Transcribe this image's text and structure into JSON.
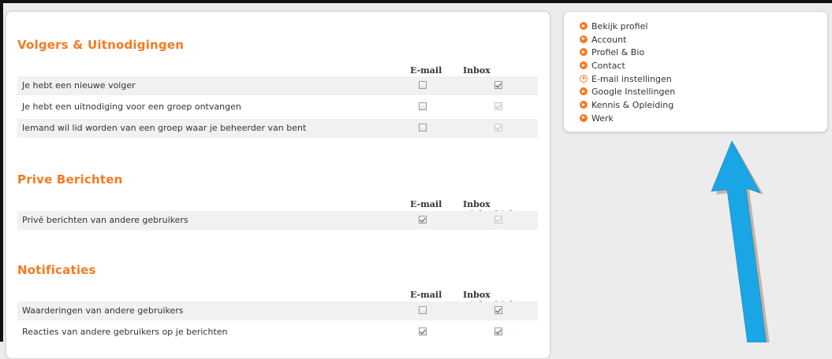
{
  "sections": [
    {
      "title": "Volgers & Uitnodigingen",
      "col_email": "E-mail",
      "col_inbox": "Inbox Biebtobieb",
      "rows": [
        {
          "label": "Je hebt een nieuwe volger",
          "email": false,
          "inbox": true,
          "inbox_disabled": false
        },
        {
          "label": "Je hebt een uitnodiging voor een groep ontvangen",
          "email": false,
          "inbox": true,
          "inbox_disabled": true
        },
        {
          "label": "Iemand wil lid worden van een groep waar je beheerder van bent",
          "email": false,
          "inbox": true,
          "inbox_disabled": true
        }
      ]
    },
    {
      "title": "Prive Berichten",
      "col_email": "E-mail",
      "col_inbox": "Inbox Biebtobieb",
      "rows": [
        {
          "label": "Privé berichten van andere gebruikers",
          "email": true,
          "inbox": true,
          "inbox_disabled": true
        }
      ]
    },
    {
      "title": "Notificaties",
      "col_email": "E-mail",
      "col_inbox": "Inbox Biebtobieb",
      "rows": [
        {
          "label": "Waarderingen van andere gebruikers",
          "email": false,
          "inbox": true,
          "inbox_disabled": false
        },
        {
          "label": "Reacties van andere gebruikers op je berichten",
          "email": true,
          "inbox": true,
          "inbox_disabled": false
        }
      ]
    }
  ],
  "sidebar": {
    "items": [
      {
        "label": "Bekijk profiel",
        "active": false
      },
      {
        "label": "Account",
        "active": false
      },
      {
        "label": "Profiel & Bio",
        "active": false
      },
      {
        "label": "Contact",
        "active": false
      },
      {
        "label": "E-mail instellingen",
        "active": true
      },
      {
        "label": "Google Instellingen",
        "active": false
      },
      {
        "label": "Kennis & Opleiding",
        "active": false
      },
      {
        "label": "Werk",
        "active": false
      }
    ]
  },
  "annotation": {
    "arrow_color": "#1aa6e6",
    "arrow_direction": "up"
  },
  "colors": {
    "accent": "#f47b20",
    "row_bg": "#f1f1f1"
  }
}
